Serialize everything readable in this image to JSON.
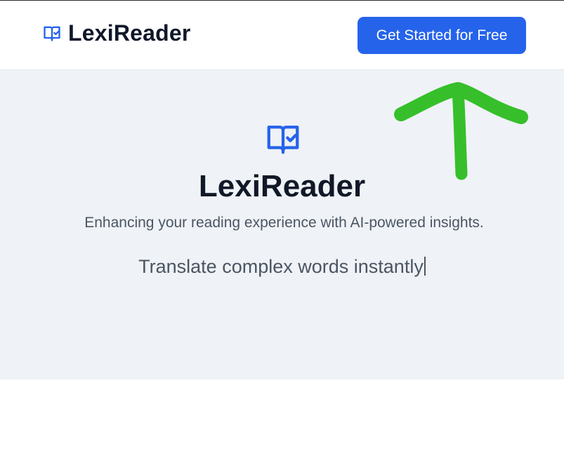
{
  "header": {
    "brand_name": "LexiReader",
    "brand_icon": "book-check-icon",
    "cta_label": "Get Started for Free"
  },
  "hero": {
    "icon": "book-check-icon",
    "title": "LexiReader",
    "subtitle": "Enhancing your reading experience with AI-powered insights.",
    "typing_text": "Translate complex words instantly"
  },
  "annotation": {
    "shape": "arrow-up",
    "color": "#36bf2b"
  },
  "colors": {
    "accent": "#2563eb",
    "hero_background": "#eff2f6",
    "title_text": "#111827",
    "body_text": "#4b5563"
  }
}
